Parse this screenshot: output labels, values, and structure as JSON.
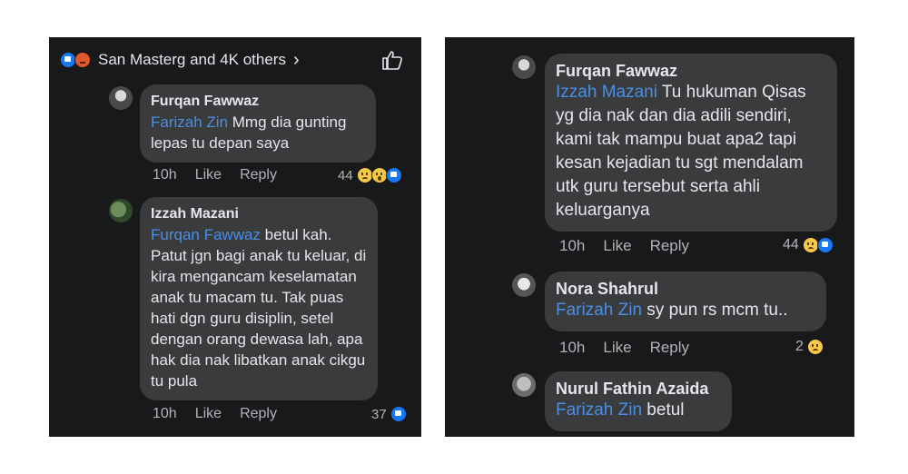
{
  "left": {
    "reactions": {
      "text": "San Masterg and 4K others",
      "chevron": "›",
      "icons": [
        "like-icon",
        "angry-icon"
      ]
    },
    "comments": [
      {
        "author": "Furqan Fawwaz",
        "mention": "Farizah Zin",
        "text": " Mmg dia gunting lepas tu depan saya",
        "time": "10h",
        "like": "Like",
        "reply": "Reply",
        "count": "44"
      },
      {
        "author": "Izzah Mazani",
        "mention": "Furqan Fawwaz",
        "text": " betul kah. Patut jgn bagi anak tu keluar, di kira mengancam keselamatan anak tu macam tu. Tak puas hati dgn guru disiplin, setel dengan orang dewasa lah, apa hak dia nak libatkan anak cikgu tu pula",
        "time": "10h",
        "like": "Like",
        "reply": "Reply",
        "count": "37"
      }
    ]
  },
  "right": {
    "comments": [
      {
        "author": "Furqan Fawwaz",
        "mention": "Izzah Mazani",
        "text": " Tu hukuman Qisas yg dia nak dan dia adili sendiri, kami tak mampu buat apa2 tapi kesan kejadian tu sgt mendalam utk guru tersebut serta ahli keluarganya",
        "time": "10h",
        "like": "Like",
        "reply": "Reply",
        "count": "44"
      },
      {
        "author": "Nora Shahrul",
        "mention": "Farizah Zin",
        "text": " sy pun rs mcm tu..",
        "time": "10h",
        "like": "Like",
        "reply": "Reply",
        "count": "2"
      },
      {
        "author": "Nurul Fathin Azaida",
        "mention": "Farizah Zin",
        "text": " betul"
      }
    ]
  },
  "colors": {
    "panel_bg": "#18191a",
    "bubble_bg": "#3a3b3c",
    "mention": "#4b8ee6",
    "text": "#e4e6eb",
    "muted": "#b0b3b8",
    "like_blue": "#1877f2"
  }
}
